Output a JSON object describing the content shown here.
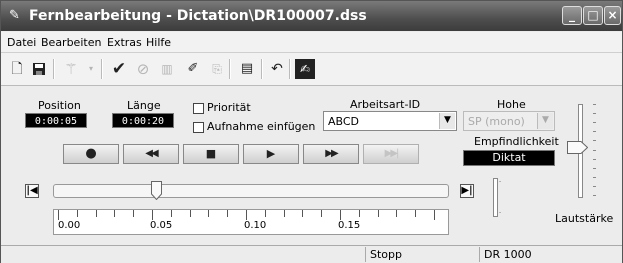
{
  "window": {
    "title": "Fernbearbeitung - Dictation\\DR100007.dss",
    "title_icon": "pencil-icon",
    "controls": [
      "minimize",
      "maximize",
      "close"
    ]
  },
  "menu": [
    "Datei",
    "Bearbeiten",
    "Extras",
    "Hilfe"
  ],
  "toolbar": [
    {
      "name": "new-document-icon",
      "enabled": true
    },
    {
      "name": "save-icon",
      "enabled": true
    },
    {
      "name": "magic-wand-icon",
      "enabled": false
    },
    {
      "name": "checkmark-icon",
      "enabled": true
    },
    {
      "name": "cancel-circle-icon",
      "enabled": false
    },
    {
      "name": "book-icon",
      "enabled": false
    },
    {
      "name": "pen-cut-icon",
      "enabled": true
    },
    {
      "name": "stamp-icon",
      "enabled": false
    },
    {
      "name": "properties-icon",
      "enabled": true
    },
    {
      "name": "undo-arrow-icon",
      "enabled": true
    },
    {
      "name": "edit-dictation-icon",
      "enabled": true
    }
  ],
  "position": {
    "label": "Position",
    "value": "0:00:05"
  },
  "length": {
    "label": "Länge",
    "value": "0:00:20"
  },
  "priority": {
    "label": "Priorität",
    "checked": false
  },
  "insert_recording": {
    "label": "Aufnahme einfügen",
    "checked": false
  },
  "worktype": {
    "label": "Arbeitsart-ID",
    "value": "ABCD"
  },
  "quality": {
    "label": "Hohe",
    "value": "SP (mono)",
    "enabled": false
  },
  "sensitivity": {
    "label": "Empfindlichkeit",
    "value": "Diktat"
  },
  "volume": {
    "label": "Lautstärke"
  },
  "transport": [
    {
      "name": "record-button",
      "glyph": "●",
      "enabled": true
    },
    {
      "name": "rewind-button",
      "glyph": "◀◀",
      "enabled": true
    },
    {
      "name": "stop-button",
      "glyph": "■",
      "enabled": true
    },
    {
      "name": "play-button",
      "glyph": "▶",
      "enabled": true
    },
    {
      "name": "fast-forward-button",
      "glyph": "▶▶",
      "enabled": true
    },
    {
      "name": "end-button",
      "glyph": "▶▶|",
      "enabled": false
    }
  ],
  "nav": {
    "start_glyph": "|◀",
    "end_glyph": "▶|"
  },
  "timeline": {
    "playhead_seconds": 5,
    "labels": [
      "0.00",
      "0.05",
      "0.10",
      "0.15"
    ]
  },
  "status": {
    "state": "Stopp",
    "device": "DR 1000"
  }
}
